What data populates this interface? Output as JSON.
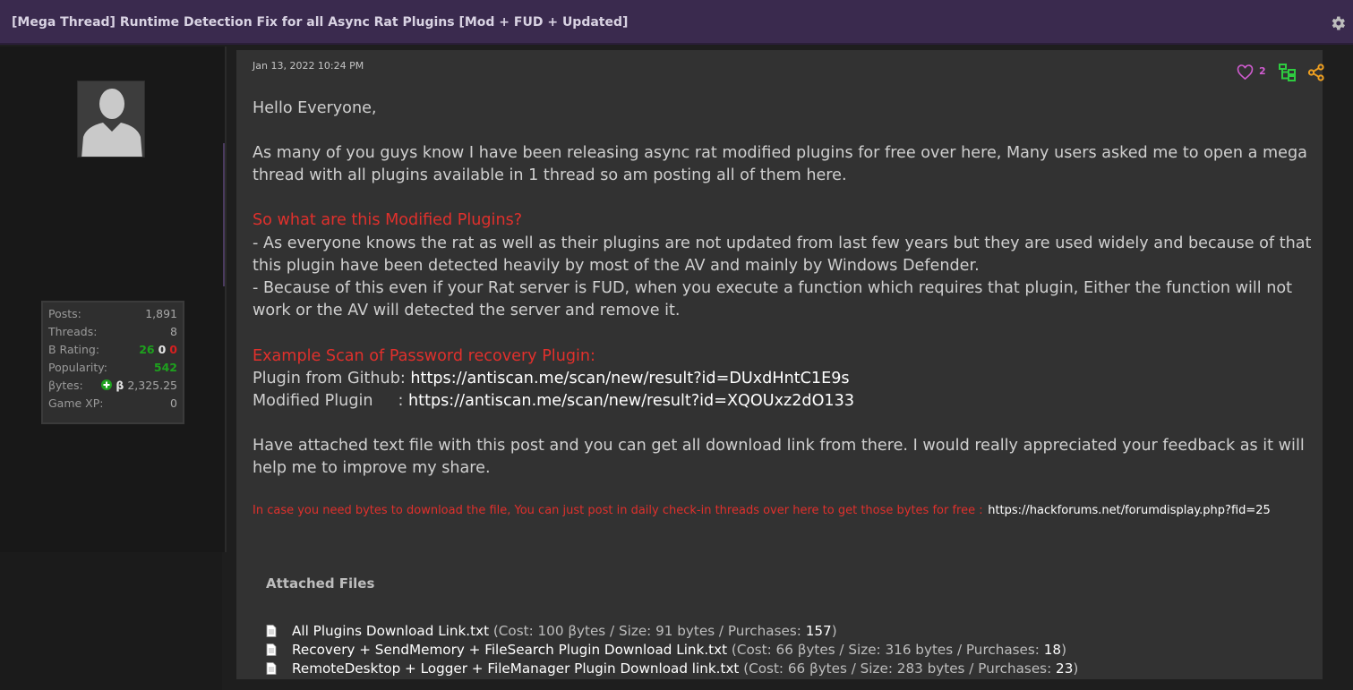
{
  "thread": {
    "title": "[Mega Thread] Runtime Detection Fix for all Async Rat Plugins [Mod + FUD + Updated]"
  },
  "author": {
    "stats": {
      "posts_label": "Posts:",
      "posts_value": "1,891",
      "threads_label": "Threads:",
      "threads_value": "8",
      "b_rating_label": "B Rating:",
      "b_rating_pos": "26",
      "b_rating_neu": "0",
      "b_rating_neg": "0",
      "popularity_label": "Popularity:",
      "popularity_value": "542",
      "bytes_label": "βytes:",
      "bytes_symbol": "β",
      "bytes_value": "2,325.25",
      "gamexp_label": "Game XP:",
      "gamexp_value": "0"
    }
  },
  "post": {
    "date": "Jan 13, 2022 10:24 PM",
    "like_count": "2",
    "greeting": "Hello Everyone,",
    "intro": "As many of you guys know I have been releasing async rat modified plugins for free over here, Many users asked me to open a mega thread with all plugins available in 1 thread so am posting all of them here.",
    "section1_heading": "So what are this Modified Plugins?",
    "section1_p1": "- As everyone knows the rat as well as their plugins are not updated from last few years but they are used widely and because of that this plugin have been detected heavily by most of the AV and mainly by Windows Defender.",
    "section1_p2": "- Because of this even if your Rat server is FUD, when you execute a function which requires that plugin, Either the function will not work or the AV will detected the server and remove it.",
    "section2_heading": "Example Scan of Password recovery Plugin:",
    "scan1_label": "Plugin from Github:",
    "scan1_link": "https://antiscan.me/scan/new/result?id=DUxdHntC1E9s",
    "scan2_label": "Modified Plugin     :",
    "scan2_link": "https://antiscan.me/scan/new/result?id=XQOUxz2dO133",
    "closing": "Have attached text file with this post and you can get all download link from there. I would really appreciated your feedback as it will help me to improve my share.",
    "note": "In case you need bytes to download the file, You can just post in daily check-in threads over here to get those bytes for free :",
    "note_link": "https://hackforums.net/forumdisplay.php?fid=25"
  },
  "attachments": {
    "title": "Attached Files",
    "files": [
      {
        "name": "All Plugins Download Link.txt",
        "meta": "(Cost: 100 βytes / Size: 91 bytes / Purchases:",
        "purchases": "157",
        "close": ")"
      },
      {
        "name": "Recovery + SendMemory + FileSearch Plugin Download Link.txt",
        "meta": "(Cost: 66 βytes / Size: 316 bytes / Purchases:",
        "purchases": "18",
        "close": ")"
      },
      {
        "name": "RemoteDesktop + Logger + FileManager Plugin Download link.txt",
        "meta": "(Cost: 66 βytes / Size: 283 bytes / Purchases:",
        "purchases": "23",
        "close": ")"
      }
    ]
  },
  "colors": {
    "title_bar": "#3a2a4e",
    "heading_red": "#e0302c",
    "like_pink": "#d05cd0",
    "tree_green": "#2ecc40",
    "share_orange": "#f0a020",
    "rating_green": "#1ea11e"
  },
  "icons": [
    "gear-icon",
    "avatar-silhouette-icon",
    "heart-icon",
    "tree-icon",
    "share-icon",
    "plus-icon",
    "file-icon"
  ]
}
